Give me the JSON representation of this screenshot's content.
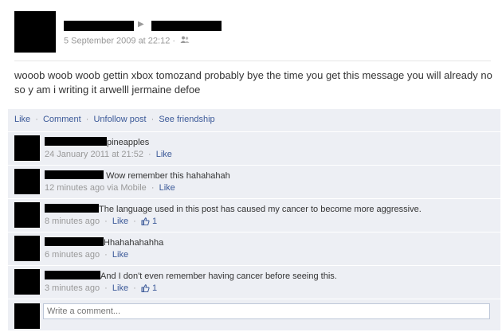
{
  "post": {
    "timestamp": "5 September 2009 at 22:12",
    "dot": "·",
    "arrow": "▶",
    "text": "wooob woob woob gettin xbox tomozand probably bye the time you get this message you will already no so y am i writing it arwelll jermaine defoe"
  },
  "actions": {
    "like": "Like",
    "comment": "Comment",
    "unfollow": "Unfollow post",
    "friendship": "See friendship",
    "sep": "·"
  },
  "comments": [
    {
      "text": "pineapples",
      "time": "24 January 2011 at 21:52",
      "via": "",
      "like": "Like",
      "likes": ""
    },
    {
      "text": "Wow remember this hahahahah",
      "time": "12 minutes ago",
      "via": "via Mobile",
      "like": "Like",
      "likes": ""
    },
    {
      "text": "The language used in this post has caused my cancer to become more aggressive.",
      "time": "8 minutes ago",
      "via": "",
      "like": "Like",
      "likes": "1"
    },
    {
      "text": "Hhahahahahha",
      "time": "6 minutes ago",
      "via": "",
      "like": "Like",
      "likes": ""
    },
    {
      "text": "And I don't even remember having cancer before seeing this.",
      "time": "3 minutes ago",
      "via": "",
      "like": "Like",
      "likes": "1"
    }
  ],
  "write_comment": {
    "placeholder": "Write a comment..."
  },
  "colors": {
    "link": "#3b5998",
    "panel": "#edeff4",
    "meta": "#999999"
  }
}
